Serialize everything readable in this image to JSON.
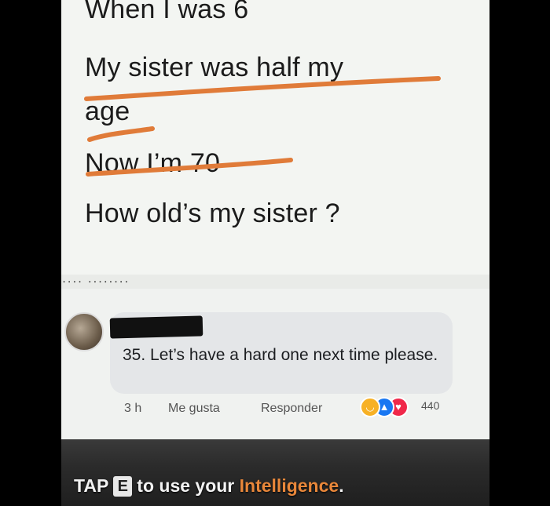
{
  "post": {
    "lines": [
      "When I was 6",
      "My sister was half my",
      "age",
      "Now I’m 70",
      "How old’s my sister ?"
    ],
    "cutoff_text": "···· ········"
  },
  "comment": {
    "text": "35. Let’s have a hard one next time please.",
    "actions": {
      "time": "3 h",
      "like": "Me gusta",
      "reply": "Responder"
    },
    "reaction_count": "440",
    "reaction_icons": [
      "haha-icon",
      "like-icon",
      "love-icon"
    ]
  },
  "prompt": {
    "tap": "TAP",
    "key": "E",
    "middle": "to use your",
    "highlight": "Intelligence",
    "end": "."
  },
  "colors": {
    "scribble": "#e07b39",
    "highlight": "#e9873a",
    "reaction_like": "#1877f2",
    "reaction_love": "#f0284a",
    "reaction_haha": "#f7b125"
  }
}
